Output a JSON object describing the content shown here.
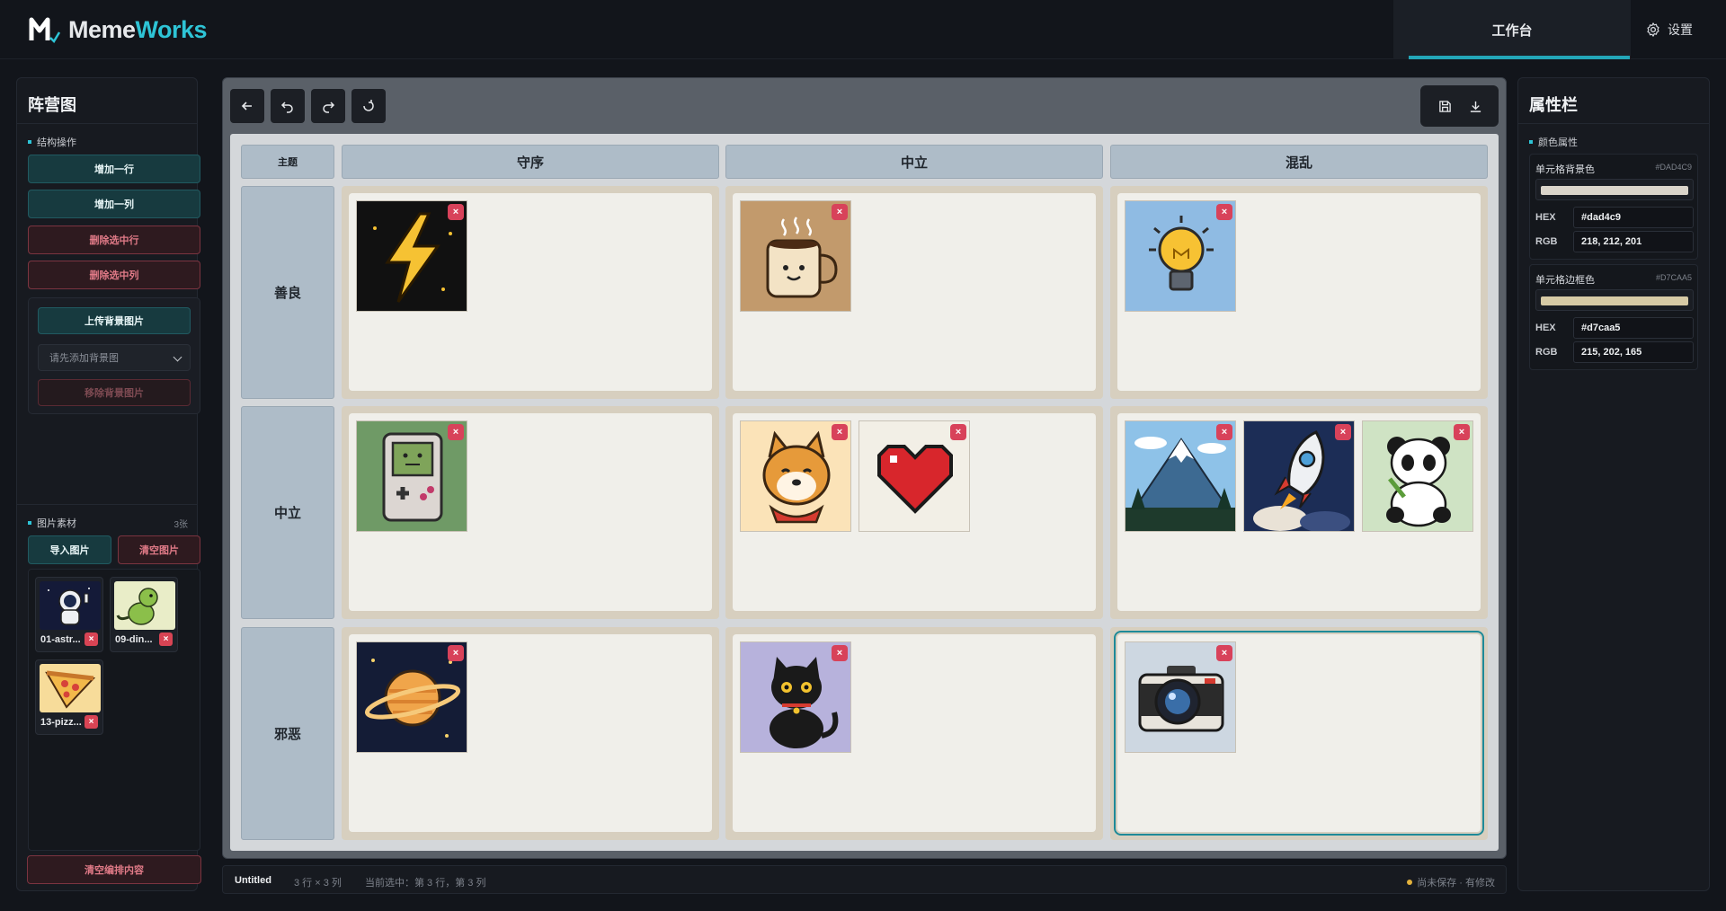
{
  "app": {
    "brand_a": "Meme",
    "brand_b": "Works"
  },
  "nav": {
    "workspace": "工作台",
    "settings": "设置"
  },
  "left": {
    "title": "阵营图",
    "structure_section": "结构操作",
    "add_row": "增加一行",
    "add_col": "增加一列",
    "del_row": "删除选中行",
    "del_col": "删除选中列",
    "upload_bg": "上传背景图片",
    "bg_select_placeholder": "请先添加背景图",
    "remove_bg": "移除背景图片",
    "assets_section": "图片素材",
    "assets_count": "3张",
    "import": "导入图片",
    "clear_images": "清空图片",
    "assets": [
      {
        "label": "01-astr...",
        "icon": "astronaut-image"
      },
      {
        "label": "09-din...",
        "icon": "dinosaur-image"
      },
      {
        "label": "13-pizz...",
        "icon": "pizza-image"
      }
    ],
    "clear_all": "清空编排内容"
  },
  "grid": {
    "corner": "主题",
    "columns": [
      "守序",
      "中立",
      "混乱"
    ],
    "rows": [
      "善良",
      "中立",
      "邪恶"
    ],
    "cells": [
      [
        [
          "lightning-image"
        ],
        [
          "coffee-image"
        ],
        [
          "lightbulb-image"
        ]
      ],
      [
        [
          "gameboy-image"
        ],
        [
          "shiba-image",
          "heart-image"
        ],
        [
          "mountain-image",
          "rocket-image",
          "panda-image"
        ]
      ],
      [
        [
          "planet-image"
        ],
        [
          "cat-image"
        ],
        [
          "camera-image"
        ]
      ]
    ],
    "remove_glyph": "×"
  },
  "status": {
    "doc": "Untitled",
    "size": "3 行 × 3 列",
    "selection": "当前选中：第 3 行，第 3 列",
    "save_state": "尚未保存 · 有修改"
  },
  "right": {
    "title": "属性栏",
    "section": "颜色属性",
    "bg": {
      "label": "单元格背景色",
      "code": "#DAD4C9",
      "hex_key": "HEX",
      "hex": "#dad4c9",
      "rgb_key": "RGB",
      "rgb": "218, 212, 201",
      "color": "#dad4c9"
    },
    "border": {
      "label": "单元格边框色",
      "code": "#D7CAA5",
      "hex_key": "HEX",
      "hex": "#d7caa5",
      "rgb_key": "RGB",
      "rgb": "215, 202, 165",
      "color": "#d7caa5"
    }
  },
  "colors": {
    "accent": "#2ec4d6",
    "danger": "#d84454"
  }
}
